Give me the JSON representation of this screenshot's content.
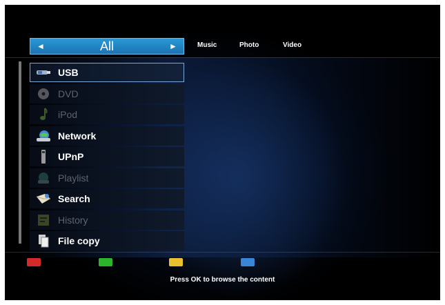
{
  "category": {
    "current": "All",
    "prev_arrow": "◄",
    "next_arrow": "►"
  },
  "tabs": [
    {
      "label": "Music"
    },
    {
      "label": "Photo"
    },
    {
      "label": "Video"
    }
  ],
  "menu": [
    {
      "label": "USB",
      "icon": "usb-icon",
      "state": "selected"
    },
    {
      "label": "DVD",
      "icon": "disc-icon",
      "state": "disabled"
    },
    {
      "label": "iPod",
      "icon": "music-note-icon",
      "state": "disabled"
    },
    {
      "label": "Network",
      "icon": "network-globe-icon",
      "state": "enabled"
    },
    {
      "label": "UPnP",
      "icon": "upnp-device-icon",
      "state": "enabled"
    },
    {
      "label": "Playlist",
      "icon": "playlist-icon",
      "state": "disabled"
    },
    {
      "label": "Search",
      "icon": "search-envelope-icon",
      "state": "enabled"
    },
    {
      "label": "History",
      "icon": "history-icon",
      "state": "disabled"
    },
    {
      "label": "File copy",
      "icon": "file-copy-icon",
      "state": "enabled"
    }
  ],
  "color_keys": [
    {
      "name": "red",
      "color": "#d42a2a"
    },
    {
      "name": "green",
      "color": "#2cb52c"
    },
    {
      "name": "yellow",
      "color": "#e8c030"
    },
    {
      "name": "blue",
      "color": "#3a86d6"
    }
  ],
  "hint": "Press OK to browse the content"
}
